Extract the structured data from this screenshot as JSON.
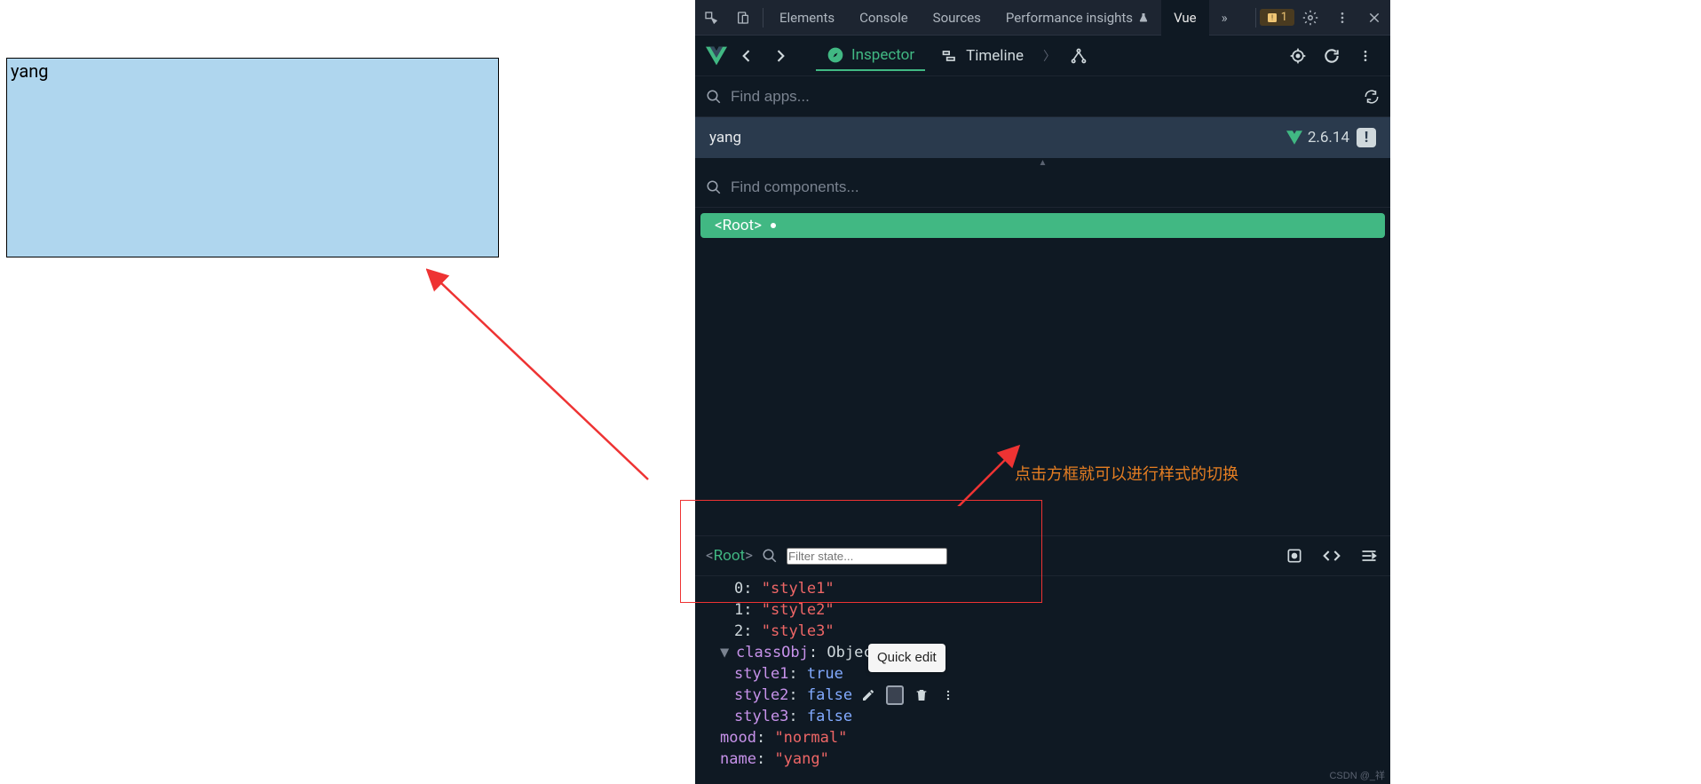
{
  "preview": {
    "text": "yang"
  },
  "devtools_tabs": {
    "elements": "Elements",
    "console": "Console",
    "sources": "Sources",
    "perf": "Performance insights",
    "vue": "Vue",
    "overflow": "»",
    "warn_count": "1"
  },
  "vue_tabs": {
    "inspector": "Inspector",
    "timeline": "Timeline"
  },
  "search": {
    "apps_placeholder": "Find apps...",
    "components_placeholder": "Find components...",
    "state_placeholder": "Filter state..."
  },
  "app": {
    "name": "yang",
    "version": "2.6.14"
  },
  "tree": {
    "root_label": "<Root>"
  },
  "state_crumb": {
    "lt": "<",
    "root": "Root",
    "gt": ">"
  },
  "state": {
    "arr": [
      {
        "k": "0",
        "v": "\"style1\""
      },
      {
        "k": "1",
        "v": "\"style2\""
      },
      {
        "k": "2",
        "v": "\"style3\""
      }
    ],
    "classObj_label": "classObj",
    "classObj_type": "Object",
    "classObj": {
      "style1_k": "style1",
      "style1_v": "true",
      "style2_k": "style2",
      "style2_v": "false",
      "style3_k": "style3",
      "style3_v": "false"
    },
    "mood_k": "mood",
    "mood_v": "\"normal\"",
    "name_k": "name",
    "name_v": "\"yang\""
  },
  "tooltip": {
    "quick_edit": "Quick edit"
  },
  "annotation": {
    "text": "点击方框就可以进行样式的切换"
  },
  "watermark": "CSDN @_祥"
}
